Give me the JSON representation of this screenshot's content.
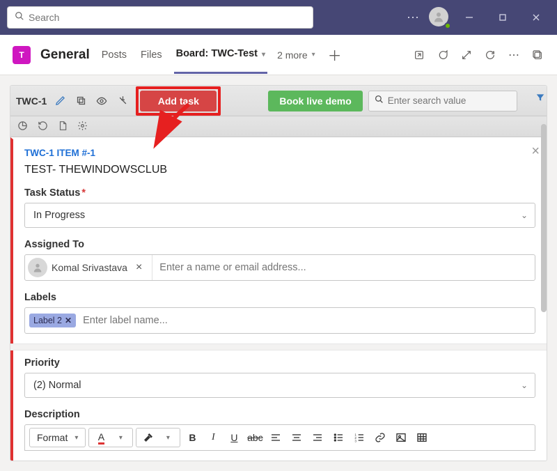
{
  "titlebar": {
    "search_placeholder": "Search",
    "team_initial": "T"
  },
  "channel": {
    "name": "General",
    "tabs": {
      "posts": "Posts",
      "files": "Files",
      "board": "Board: TWC-Test",
      "more": "2 more"
    }
  },
  "toolbar": {
    "project_label": "TWC-1",
    "add_task": "Add task",
    "demo": "Book live demo",
    "search_placeholder": "Enter search value"
  },
  "form": {
    "item_id": "TWC-1 ITEM #-1",
    "title": "TEST- THEWINDOWSCLUB",
    "status_label": "Task Status",
    "status_value": "In Progress",
    "assigned_label": "Assigned To",
    "assigned_chip": "Komal Srivastava",
    "assigned_placeholder": "Enter a name or email address...",
    "labels_label": "Labels",
    "label_chip": "Label 2",
    "labels_placeholder": "Enter label name...",
    "priority_label": "Priority",
    "priority_value": "(2) Normal",
    "description_label": "Description",
    "rte_format": "Format"
  }
}
